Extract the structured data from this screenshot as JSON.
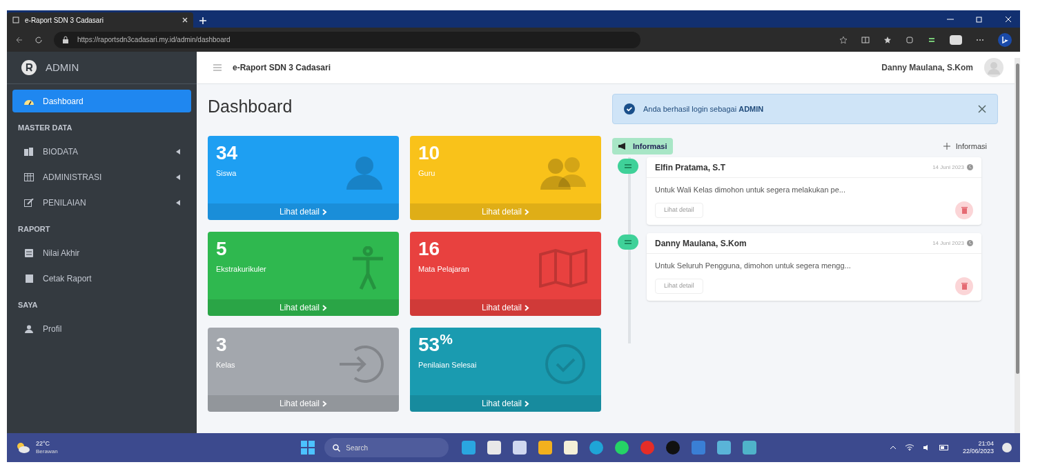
{
  "browser": {
    "tab_title": "e-Raport SDN 3 Cadasari",
    "url": "https://raportsdn3cadasari.my.id/admin/dashboard"
  },
  "sidebar": {
    "brand": "ADMIN",
    "items": [
      {
        "kind": "link",
        "label": "Dashboard",
        "selected": true
      },
      {
        "kind": "header",
        "label": "MASTER DATA"
      },
      {
        "kind": "link",
        "label": "BIODATA",
        "selected": false,
        "caret": true
      },
      {
        "kind": "link",
        "label": "ADMINISTRASI",
        "selected": false,
        "caret": true
      },
      {
        "kind": "link",
        "label": "PENILAIAN",
        "selected": false,
        "caret": true
      },
      {
        "kind": "header",
        "label": "RAPORT"
      },
      {
        "kind": "link",
        "label": "Nilai Akhir",
        "selected": false
      },
      {
        "kind": "link",
        "label": "Cetak Raport",
        "selected": false
      },
      {
        "kind": "header",
        "label": "SAYA"
      },
      {
        "kind": "link",
        "label": "Profil",
        "selected": false
      }
    ]
  },
  "navbar": {
    "title": "e-Raport SDN 3 Cadasari",
    "user": "Danny Maulana, S.Kom"
  },
  "page_title": "Dashboard",
  "stats": [
    {
      "value": "34",
      "label": "Siswa",
      "link": "Lihat detail",
      "color": "#1e9ff2"
    },
    {
      "value": "10",
      "label": "Guru",
      "link": "Lihat detail",
      "color": "#f9c21a"
    },
    {
      "value": "5",
      "label": "Ekstrakurikuler",
      "link": "Lihat detail",
      "color": "#2fb84f"
    },
    {
      "value": "16",
      "label": "Mata Pelajaran",
      "link": "Lihat detail",
      "color": "#e8413f"
    },
    {
      "value": "3",
      "label": "Kelas",
      "link": "Lihat detail",
      "color": "#a3a7ad"
    },
    {
      "value": "53$^{%}$",
      "label": "Penilaian Selesai",
      "link": "Lihat detail",
      "color": "#1a9bb0"
    }
  ],
  "alert": {
    "text": "Anda berhasil login sebagai **ADMIN**"
  },
  "info": {
    "title": "Informasi",
    "add_button": "Informasi",
    "posts": [
      {
        "author": "Elfin Pratama, S.T",
        "date": "14 Juni 2023",
        "body": "Untuk Wali Kelas dimohon untuk segera melakukan pe...",
        "link": "Lihat detail"
      },
      {
        "author": "Danny Maulana, S.Kom",
        "date": "14 Juni 2023",
        "body": "Untuk Seluruh Pengguna, dimohon untuk segera mengg...",
        "link": "Lihat detail"
      }
    ]
  },
  "taskbar": {
    "weather_temp": "22°C",
    "weather_text": "Berawan",
    "search": "Search",
    "time": "21:04",
    "date": "22/06/2023"
  }
}
